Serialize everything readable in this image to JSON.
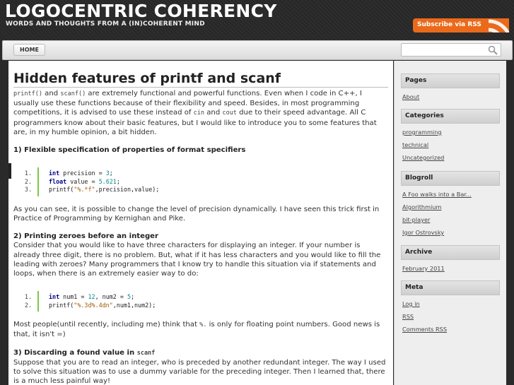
{
  "header": {
    "title": "LOGOCENTRIC COHERENCY",
    "tagline": "WORDS AND THOUGHTS FROM A (IN)COHERENT MIND",
    "rss_label": "Subscribe via RSS"
  },
  "nav": {
    "home": "HOME",
    "search_placeholder": ""
  },
  "post": {
    "title": "Hidden features of printf and scanf",
    "intro": {
      "code1": "printf()",
      "t1": " and ",
      "code2": "scanf()",
      "t2": " are extremely functional and powerful functions. Even when I code in C++, I usually use these functions because of their flexibility and speed. Besides, in most programming competitions, it is advised to use these instead of ",
      "code3": "cin",
      "t3": " and ",
      "code4": "cout",
      "t4": " due to their speed advantage. All C programmers know about their basic features, but I would like to introduce you to some features that are, in my humble opinion, a bit hidden."
    },
    "s1_title": "1) Flexible specification of properties of format specifiers",
    "code_a": {
      "l1": {
        "n": "1.",
        "kw": "int",
        "rest": " precision = ",
        "num": "3",
        "end": ";"
      },
      "l2": {
        "n": "2.",
        "kw": "float",
        "rest": " value = ",
        "num": "5.621",
        "end": ";"
      },
      "l3": {
        "n": "3.",
        "pre": "printf(",
        "str": "\"%.*f\"",
        "post": ",precision,value);"
      }
    },
    "p1": "As you can see, it is possible to change the level of precision dynamically. I have seen this trick first in Practice of Programming by Kernighan and Pike.",
    "s2_title": "2) Printing zeroes before an integer",
    "p2": "Consider that you would like to have three characters for displaying an integer. If your number is already three digit, there is no problem. But, what if it has less characters and you would like to fill the leading with zeroes? Many programmers that I know try to handle this situation via if statements and loops, when there is an extremely easier way to do:",
    "code_b": {
      "l1": {
        "n": "1.",
        "kw": "int",
        "rest1": " num1 = ",
        "num1": "12",
        "rest2": ", num2 = ",
        "num2": "5",
        "end": ";"
      },
      "l2": {
        "n": "2.",
        "pre": "printf(",
        "str": "\"%.3d%.4dn\"",
        "post": ",num1,num2);"
      }
    },
    "p3": {
      "t1": "Most people(until recently, including me) think that ",
      "code": "%.",
      "t2": " is only for floating point numbers. Good news is that, it isn't =)"
    },
    "s3_title": "3) Discarding a found value in ",
    "s3_code": "scanf",
    "p4": "Suppose that you are to read an integer, who is preceded by another redundant integer. The way I used to solve this situation was to use a dummy variable for the preceding integer. Then I learned that, there is a much less painful way!"
  },
  "sidebar": {
    "pages": {
      "title": "Pages",
      "items": [
        "About"
      ]
    },
    "categories": {
      "title": "Categories",
      "items": [
        "programming",
        "technical",
        "Uncategorized"
      ]
    },
    "blogroll": {
      "title": "Blogroll",
      "items": [
        "A Foo walks into a Bar...",
        "Algorithmium",
        "bit-player",
        "Igor Ostrovsky"
      ]
    },
    "archive": {
      "title": "Archive",
      "items": [
        "February 2011"
      ]
    },
    "meta": {
      "title": "Meta",
      "items": [
        "Log in",
        "RSS",
        "Comments RSS"
      ]
    }
  },
  "colors": {
    "accent": "#ea6a1c",
    "background": "#2a2a2a",
    "code_bar": "#7ac943",
    "keyword": "#00008b"
  }
}
